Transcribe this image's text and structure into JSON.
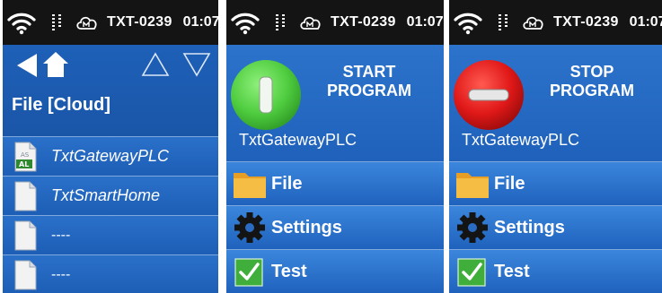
{
  "status": {
    "device_name": "TXT-0239",
    "time": "01:07",
    "icons": [
      "wifi-icon",
      "io-icon",
      "cloud-icon"
    ]
  },
  "file_screen": {
    "title": "File [Cloud]",
    "files": [
      {
        "name": "TxtGatewayPLC",
        "icon": "plc-file-icon"
      },
      {
        "name": "TxtSmartHome",
        "icon": "file-icon"
      },
      {
        "name": "----",
        "icon": "file-icon"
      },
      {
        "name": "----",
        "icon": "file-icon"
      }
    ]
  },
  "start_screen": {
    "caption_line1": "START",
    "caption_line2": "PROGRAM",
    "program_name": "TxtGatewayPLC",
    "menu": [
      {
        "label": "File",
        "icon": "folder-icon"
      },
      {
        "label": "Settings",
        "icon": "gear-icon"
      },
      {
        "label": "Test",
        "icon": "check-icon"
      }
    ]
  },
  "stop_screen": {
    "caption_line1": "STOP",
    "caption_line2": "PROGRAM",
    "program_name": "TxtGatewayPLC",
    "menu": [
      {
        "label": "File",
        "icon": "folder-icon"
      },
      {
        "label": "Settings",
        "icon": "gear-icon"
      },
      {
        "label": "Test",
        "icon": "check-icon"
      }
    ]
  },
  "colors": {
    "status_bar": "#141414",
    "panel_blue": "#1f63bd",
    "start_green": "#5bd64a",
    "stop_red": "#e01818",
    "folder_yellow": "#f3b23a"
  }
}
